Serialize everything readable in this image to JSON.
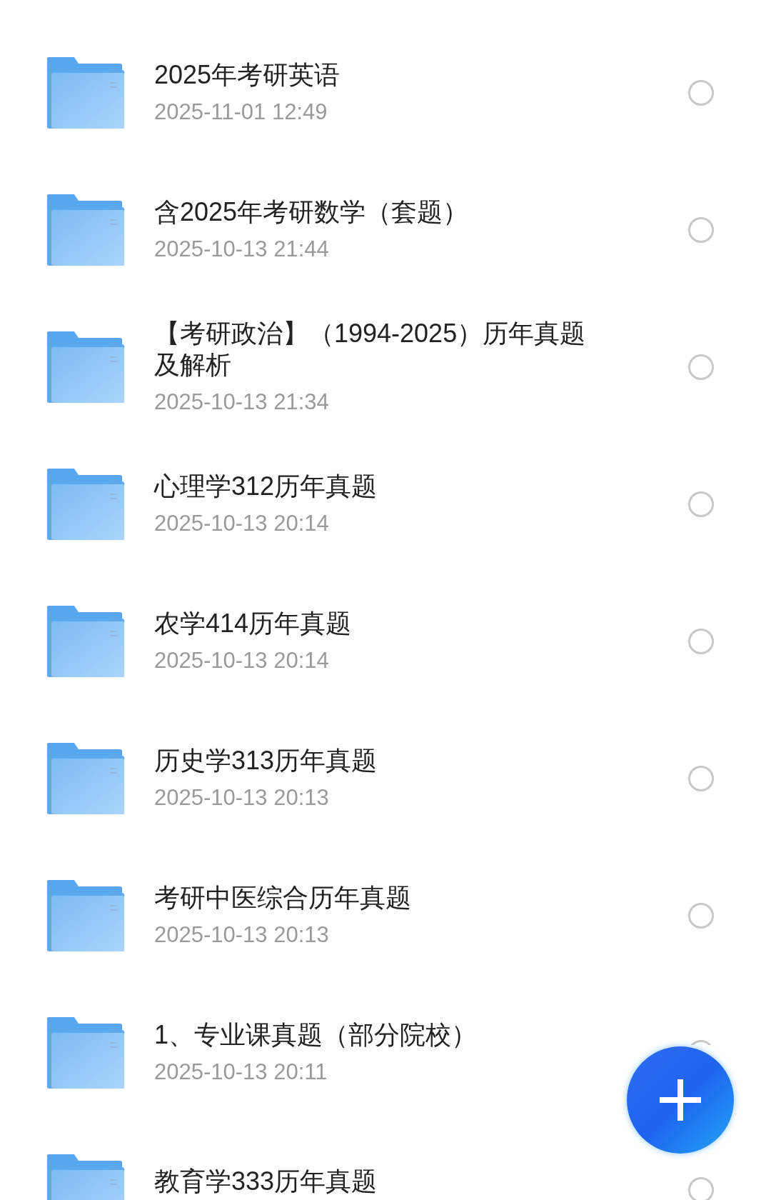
{
  "files": [
    {
      "name": "2025年考研英语",
      "date": "2025-11-01 12:49",
      "selected": false
    },
    {
      "name": "含2025年考研数学（套题）",
      "date": "2025-10-13 21:44",
      "selected": false
    },
    {
      "name": "【考研政治】（1994-2025）历年真题及解析",
      "date": "2025-10-13 21:34",
      "selected": false
    },
    {
      "name": "心理学312历年真题",
      "date": "2025-10-13 20:14",
      "selected": false
    },
    {
      "name": "农学414历年真题",
      "date": "2025-10-13 20:14",
      "selected": false
    },
    {
      "name": "历史学313历年真题",
      "date": "2025-10-13 20:13",
      "selected": false
    },
    {
      "name": "考研中医综合历年真题",
      "date": "2025-10-13 20:13",
      "selected": false
    },
    {
      "name": "1、专业课真题（部分院校）",
      "date": "2025-10-13 20:11",
      "selected": false
    },
    {
      "name": "教育学333历年真题",
      "selected": false
    }
  ]
}
